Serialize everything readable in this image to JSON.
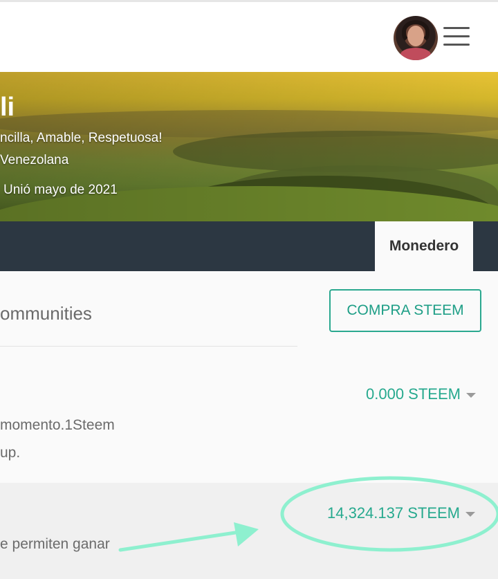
{
  "header": {
    "avatar_alt": "profile avatar",
    "menu_icon": "hamburger-menu-icon"
  },
  "profile": {
    "name_fragment": "li",
    "about": "ncilla, Amable, Respetuosa!",
    "location": "Venezolana",
    "joined": "Unió mayo de 2021"
  },
  "tabs": {
    "active": "Monedero"
  },
  "wallet": {
    "communities_label": "ommunities",
    "buy_button": "COMPRA STEEM",
    "steem_balance": "0.000 STEEM",
    "steem_desc_line1": "momento.1Steem",
    "steem_desc_line2": "up.",
    "steem_power_balance": "14,324.137 STEEM",
    "steem_power_desc": "e permiten ganar"
  },
  "annotation_colors": {
    "ellipse": "#8ef0cf",
    "arrow": "#8ef0cf",
    "accent": "#26a98e",
    "tabbar": "#2c3742"
  }
}
